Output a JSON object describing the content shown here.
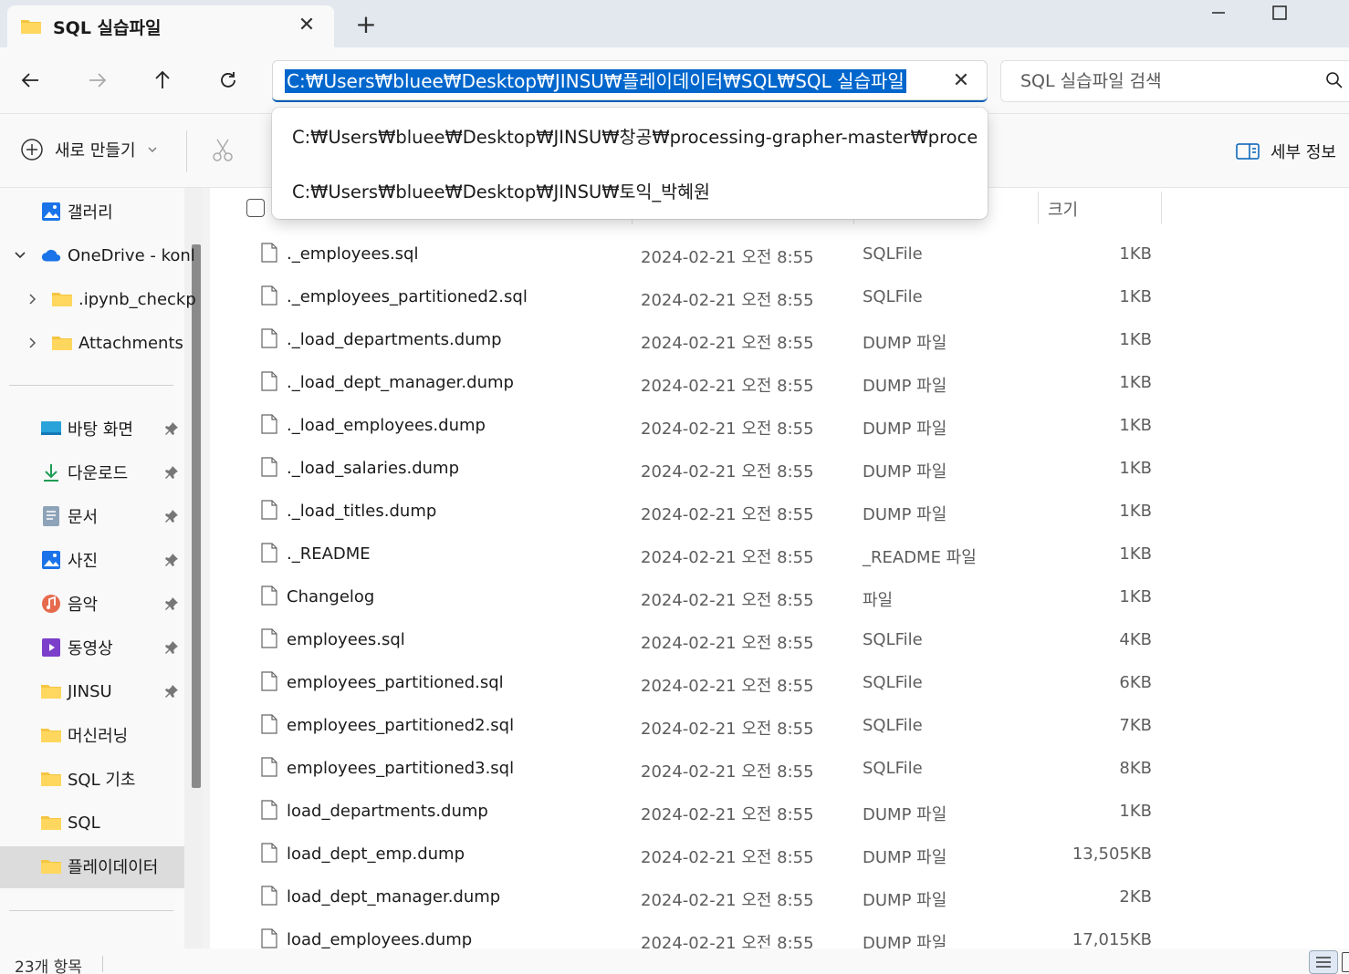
{
  "tab": {
    "title": "SQL 실습파일",
    "close": "✕",
    "new_tab": "+"
  },
  "nav": {
    "address": "C:₩Users₩bluee₩Desktop₩JINSU₩플레이데이터₩SQL₩SQL 실습파일",
    "address_clear": "✕",
    "search_placeholder": "SQL 실습파일 검색"
  },
  "suggestions": [
    "C:₩Users₩bluee₩Desktop₩JINSU₩창공₩processing-grapher-master₩processing-grapher-master",
    "C:₩Users₩bluee₩Desktop₩JINSU₩토익_박혜원"
  ],
  "commands": {
    "new": "새로 만들기",
    "details": "세부 정보"
  },
  "sidebar": {
    "gallery": "갤러리",
    "onedrive": "OneDrive - konl",
    "onedrive_children": [
      ".ipynb_checkp",
      "Attachments"
    ],
    "quick_access": [
      {
        "label": "바탕 화면",
        "icon": "desktop-icon",
        "pinned": true
      },
      {
        "label": "다운로드",
        "icon": "download-icon",
        "pinned": true
      },
      {
        "label": "문서",
        "icon": "document-icon",
        "pinned": true
      },
      {
        "label": "사진",
        "icon": "picture-icon",
        "pinned": true
      },
      {
        "label": "음악",
        "icon": "music-icon",
        "pinned": true
      },
      {
        "label": "동영상",
        "icon": "video-icon",
        "pinned": true
      },
      {
        "label": "JINSU",
        "icon": "folder-icon",
        "pinned": true
      },
      {
        "label": "머신러닝",
        "icon": "folder-icon",
        "pinned": false
      },
      {
        "label": "SQL 기초",
        "icon": "folder-icon",
        "pinned": false
      },
      {
        "label": "SQL",
        "icon": "folder-icon",
        "pinned": false
      },
      {
        "label": "플레이데이터",
        "icon": "folder-icon",
        "pinned": false
      }
    ],
    "selected": "플레이데이터"
  },
  "columns": {
    "size": "크기"
  },
  "files": [
    {
      "name": "._employees.sql",
      "date": "2024-02-21 오전 8:55",
      "type": "SQLFile",
      "size": "1KB"
    },
    {
      "name": "._employees_partitioned2.sql",
      "date": "2024-02-21 오전 8:55",
      "type": "SQLFile",
      "size": "1KB"
    },
    {
      "name": "._load_departments.dump",
      "date": "2024-02-21 오전 8:55",
      "type": "DUMP 파일",
      "size": "1KB"
    },
    {
      "name": "._load_dept_manager.dump",
      "date": "2024-02-21 오전 8:55",
      "type": "DUMP 파일",
      "size": "1KB"
    },
    {
      "name": "._load_employees.dump",
      "date": "2024-02-21 오전 8:55",
      "type": "DUMP 파일",
      "size": "1KB"
    },
    {
      "name": "._load_salaries.dump",
      "date": "2024-02-21 오전 8:55",
      "type": "DUMP 파일",
      "size": "1KB"
    },
    {
      "name": "._load_titles.dump",
      "date": "2024-02-21 오전 8:55",
      "type": "DUMP 파일",
      "size": "1KB"
    },
    {
      "name": "._README",
      "date": "2024-02-21 오전 8:55",
      "type": "_README 파일",
      "size": "1KB"
    },
    {
      "name": "Changelog",
      "date": "2024-02-21 오전 8:55",
      "type": "파일",
      "size": "1KB"
    },
    {
      "name": "employees.sql",
      "date": "2024-02-21 오전 8:55",
      "type": "SQLFile",
      "size": "4KB"
    },
    {
      "name": "employees_partitioned.sql",
      "date": "2024-02-21 오전 8:55",
      "type": "SQLFile",
      "size": "6KB"
    },
    {
      "name": "employees_partitioned2.sql",
      "date": "2024-02-21 오전 8:55",
      "type": "SQLFile",
      "size": "7KB"
    },
    {
      "name": "employees_partitioned3.sql",
      "date": "2024-02-21 오전 8:55",
      "type": "SQLFile",
      "size": "8KB"
    },
    {
      "name": "load_departments.dump",
      "date": "2024-02-21 오전 8:55",
      "type": "DUMP 파일",
      "size": "1KB"
    },
    {
      "name": "load_dept_emp.dump",
      "date": "2024-02-21 오전 8:55",
      "type": "DUMP 파일",
      "size": "13,505KB"
    },
    {
      "name": "load_dept_manager.dump",
      "date": "2024-02-21 오전 8:55",
      "type": "DUMP 파일",
      "size": "2KB"
    },
    {
      "name": "load_employees.dump",
      "date": "2024-02-21 오전 8:55",
      "type": "DUMP 파일",
      "size": "17,015KB"
    }
  ],
  "status": {
    "count": "23개 항목"
  },
  "colors": {
    "accent": "#005fb8",
    "selection": "#0066cc",
    "folder": "#f5c542",
    "onedrive": "#1a73e8"
  }
}
